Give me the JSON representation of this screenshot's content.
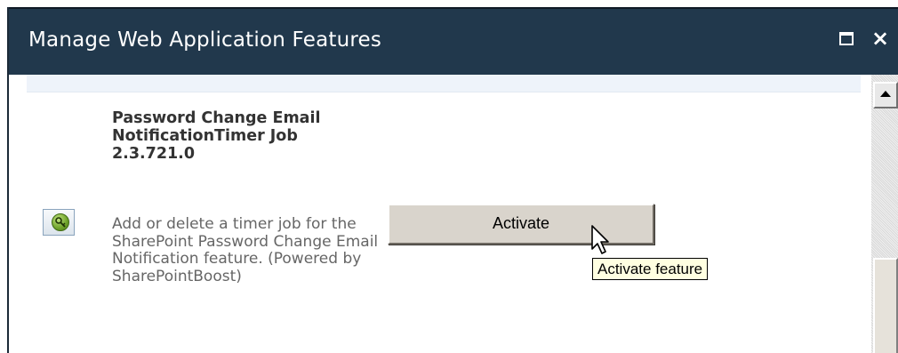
{
  "dialog": {
    "title": "Manage Web Application Features",
    "maximize_icon": "maximize-icon",
    "close_icon": "close-icon",
    "close_glyph": "×"
  },
  "feature": {
    "icon": "feature-key-icon",
    "title": "Password Change Email NotificationTimer Job 2.3.721.0",
    "description": "Add or delete a timer job for the SharePoint Password Change Email Notification feature. (Powered by SharePointBoost)",
    "action_label": "Activate",
    "tooltip": "Activate feature"
  },
  "scrollbar": {
    "up_icon": "scroll-up-arrow-icon"
  }
}
